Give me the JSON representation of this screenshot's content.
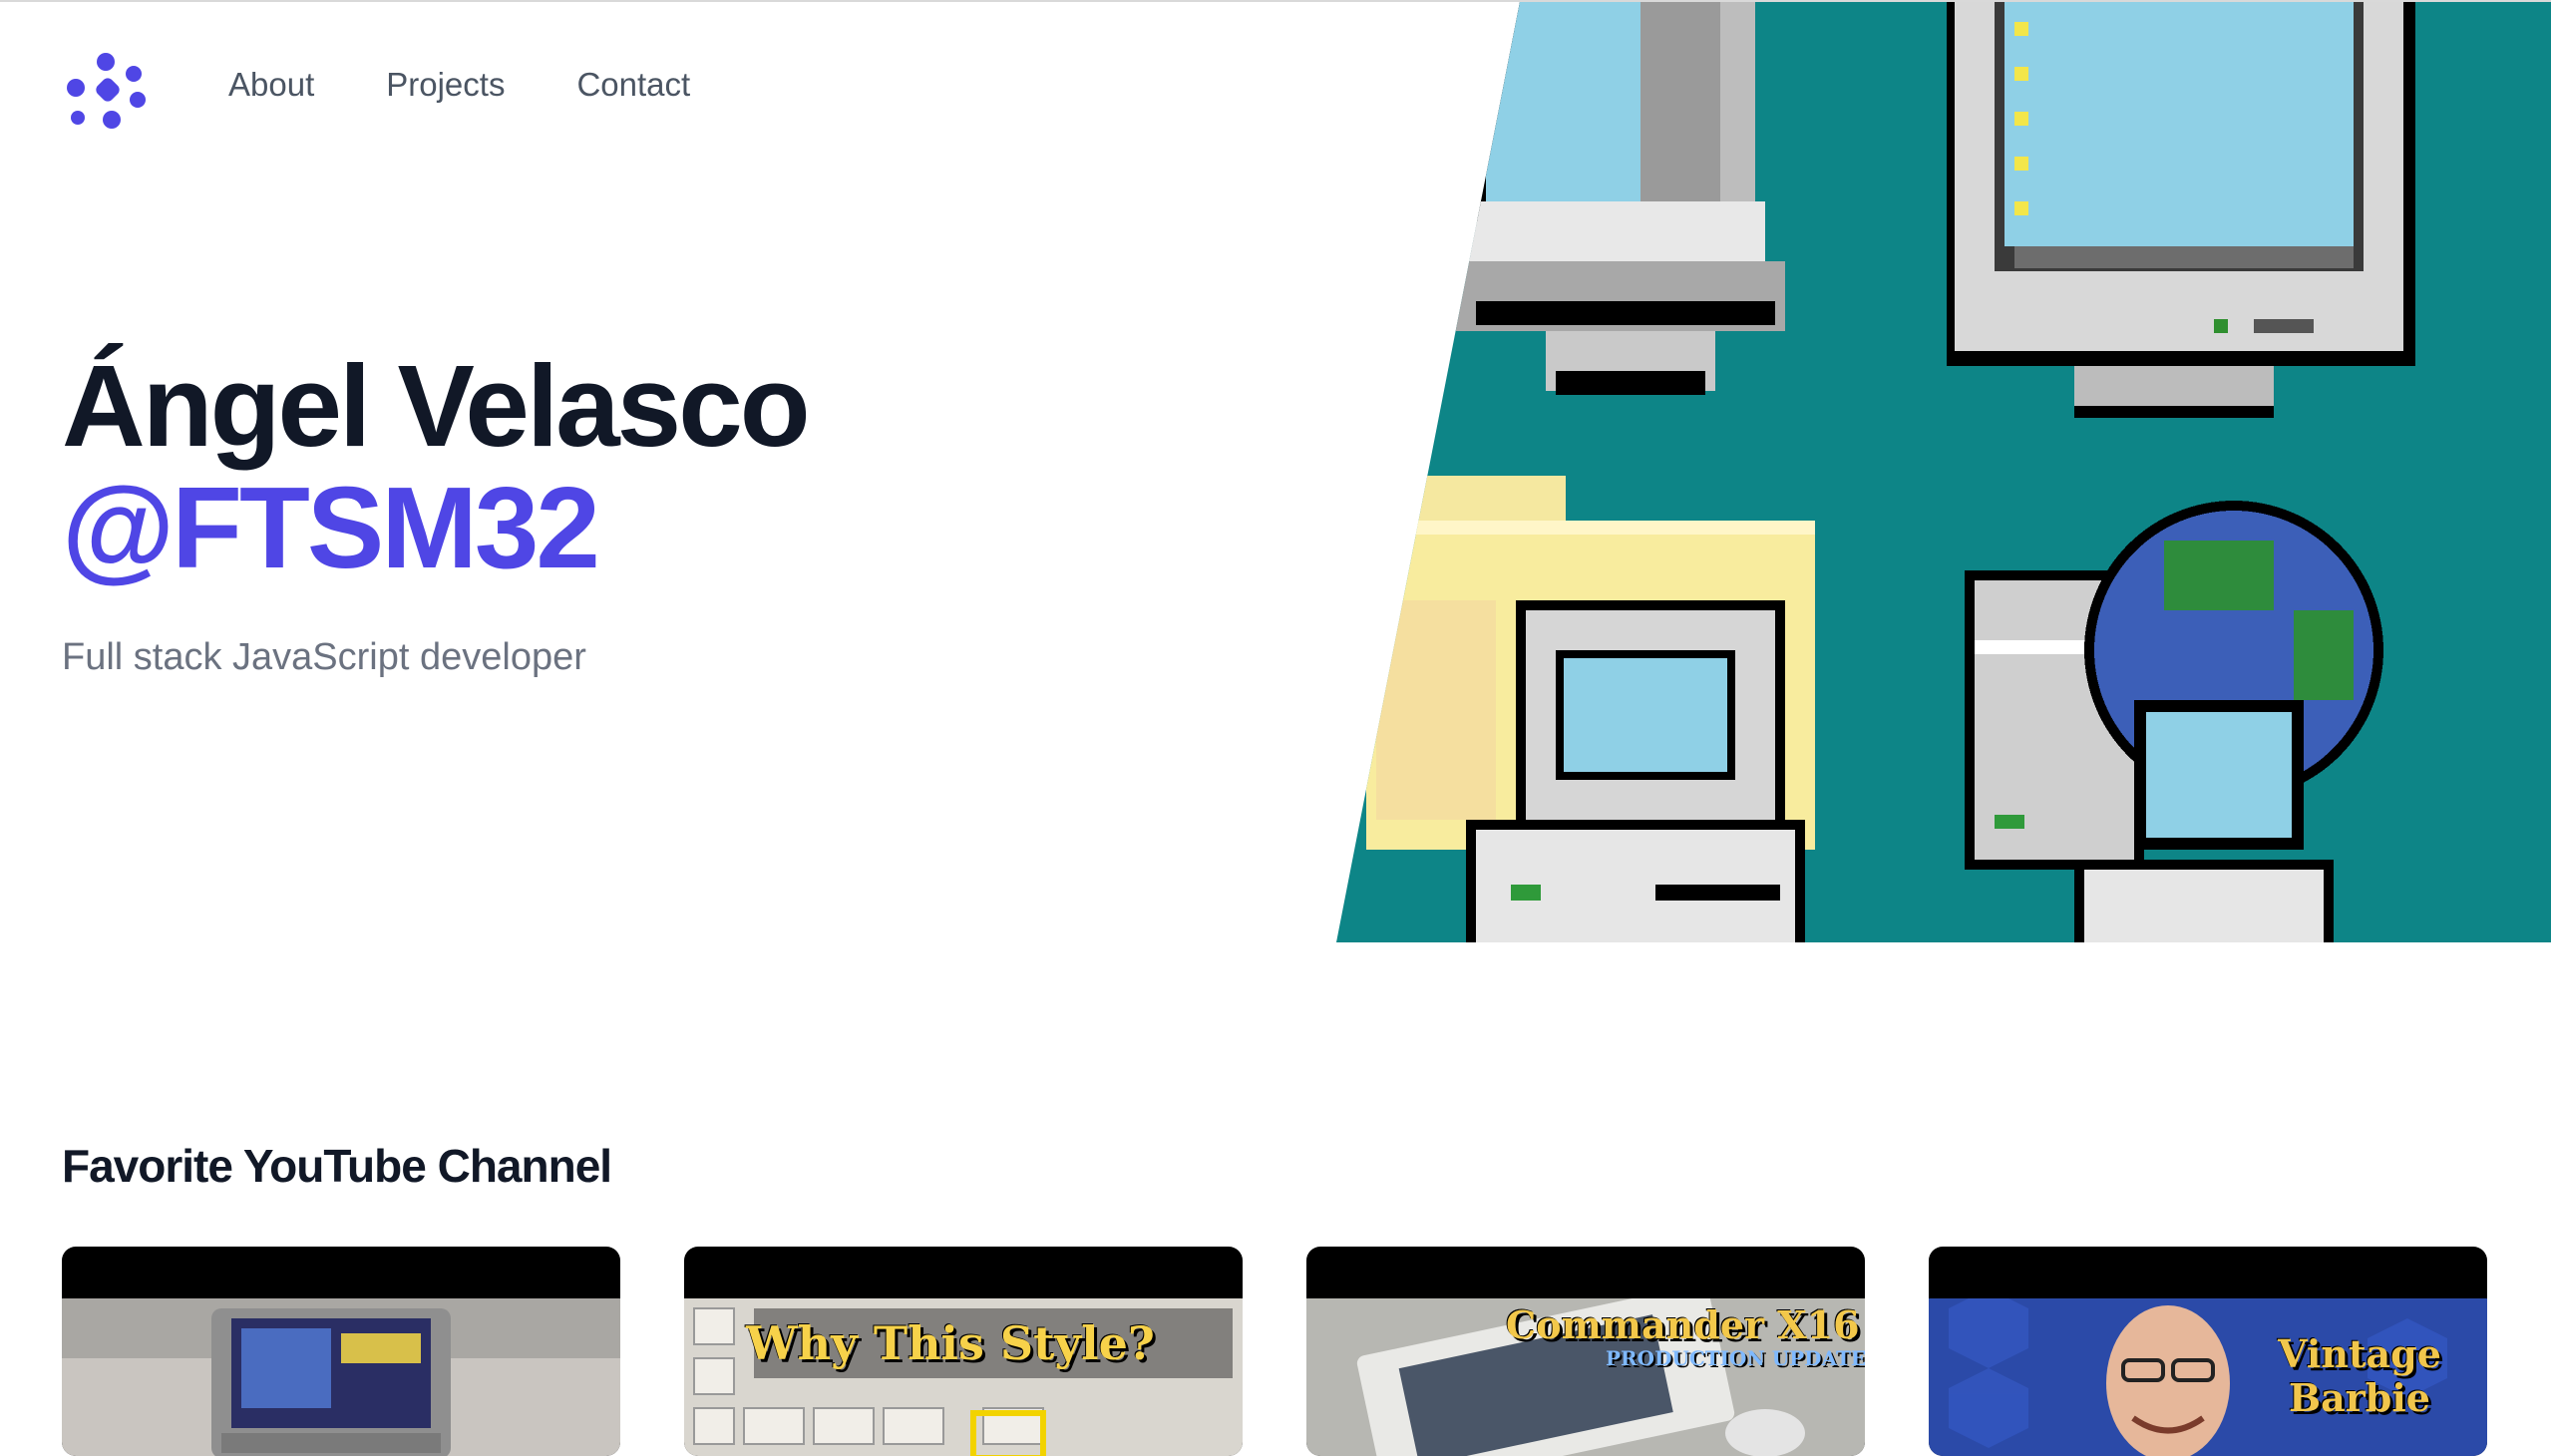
{
  "header": {
    "logo_icon": "dots-asterisk-logo-icon",
    "nav": [
      {
        "label": "About"
      },
      {
        "label": "Projects"
      },
      {
        "label": "Contact"
      }
    ]
  },
  "hero": {
    "name": "Ángel Velasco",
    "handle": "@FTSM32",
    "subtitle": "Full stack JavaScript developer",
    "art": "retro-pixel-computer-icons-illustration"
  },
  "youtube_section": {
    "title": "Favorite YouTube Channel",
    "videos": [
      {
        "thumbnail": "snes-cartridge-photo",
        "thumbnail_text": ""
      },
      {
        "thumbnail": "retro-keyboard-photo",
        "thumbnail_text": "Why This Style?"
      },
      {
        "thumbnail": "commander-x16-board-photo",
        "thumbnail_text": "Commander X16",
        "thumbnail_subtext": "PRODUCTION UPDATE"
      },
      {
        "thumbnail": "presenter-face-photo",
        "thumbnail_text": "Vintage Barbie"
      }
    ]
  },
  "colors": {
    "accent": "#4f46e5",
    "heading": "#111827",
    "muted": "#6b7280",
    "nav": "#4b5563",
    "art_background": "#0d8587"
  }
}
